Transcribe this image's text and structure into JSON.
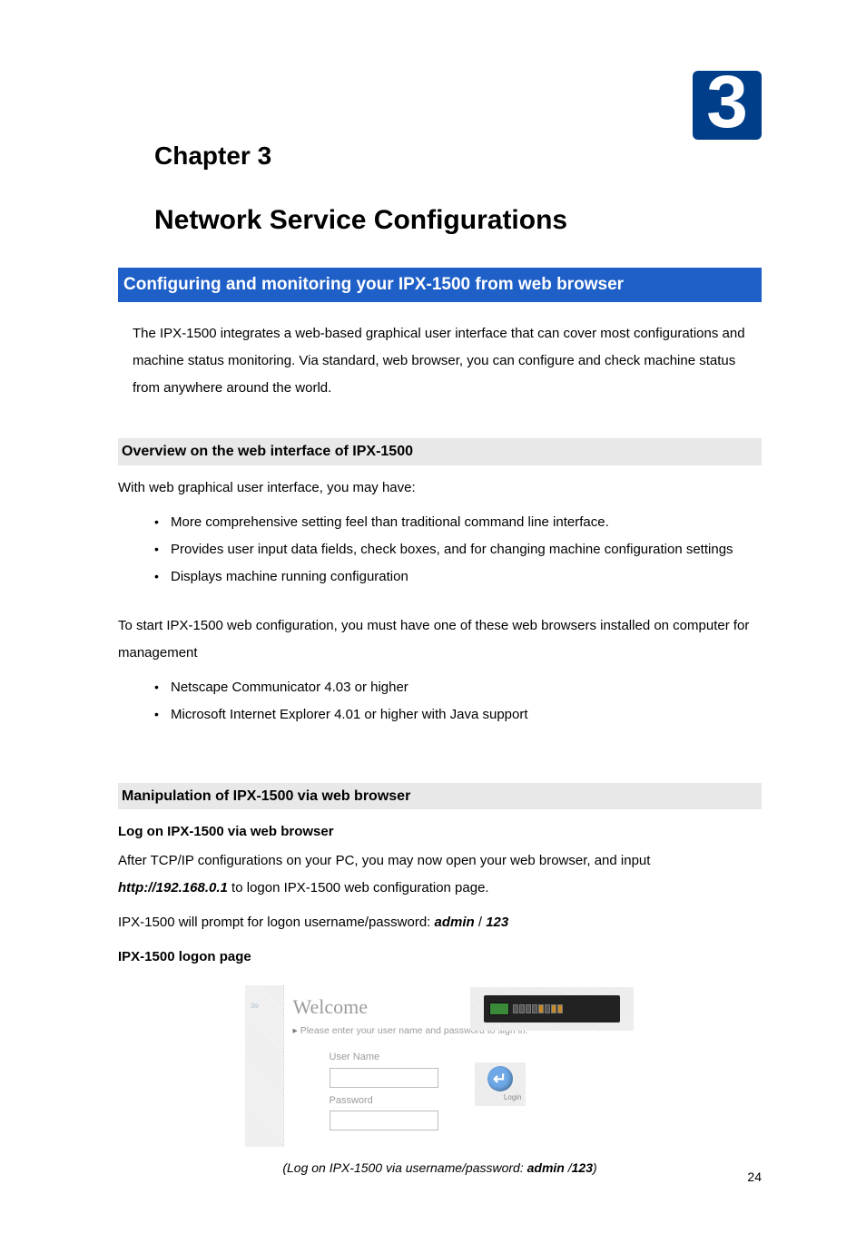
{
  "badge_number": "3",
  "chapter_label": "Chapter 3",
  "main_title": "Network Service Configurations",
  "blue_bar": "Configuring and monitoring your IPX-1500 from web browser",
  "intro": "The IPX-1500 integrates a web-based graphical user interface that can cover most configurations and machine status monitoring. Via standard, web browser, you can configure and check machine status from anywhere around the world.",
  "section1_head": "Overview on the web interface of IPX-1500",
  "section1_lead": "With web graphical user interface, you may have:",
  "section1_bullets": [
    "More comprehensive setting feel than traditional command line interface.",
    "Provides user input data fields, check boxes, and for changing machine configuration settings",
    "Displays machine running configuration"
  ],
  "section1_tail": "To start IPX-1500 web configuration, you must have one of these web browsers installed on computer for management",
  "section1_bullets2": [
    "Netscape Communicator 4.03 or higher",
    "Microsoft Internet Explorer 4.01 or higher with Java support"
  ],
  "section2_head": "Manipulation of IPX-1500 via web browser",
  "section2_sub": "Log on IPX-1500 via web browser",
  "section2_p1_a": "After TCP/IP configurations on your PC, you may now open your web browser, and input ",
  "section2_url": "http://192.168.0.1",
  "section2_p1_b": " to logon IPX-1500 web configuration page.",
  "section2_p2_a": "IPX-1500 will prompt for logon username/password: ",
  "creds_user": "admin",
  "creds_sep": " / ",
  "creds_pass": "123",
  "section2_sub2": "IPX-1500 logon page",
  "login": {
    "welcome": "Welcome",
    "prompt": "Please enter your user name and password to sign in.",
    "username_label": "User Name",
    "password_label": "Password",
    "login_label": "Login"
  },
  "caption_a": "(Log on IPX-1500 via username/password: ",
  "caption_user": "admin",
  "caption_sep": " /",
  "caption_pass": "123",
  "caption_b": ")",
  "page_number": "24"
}
